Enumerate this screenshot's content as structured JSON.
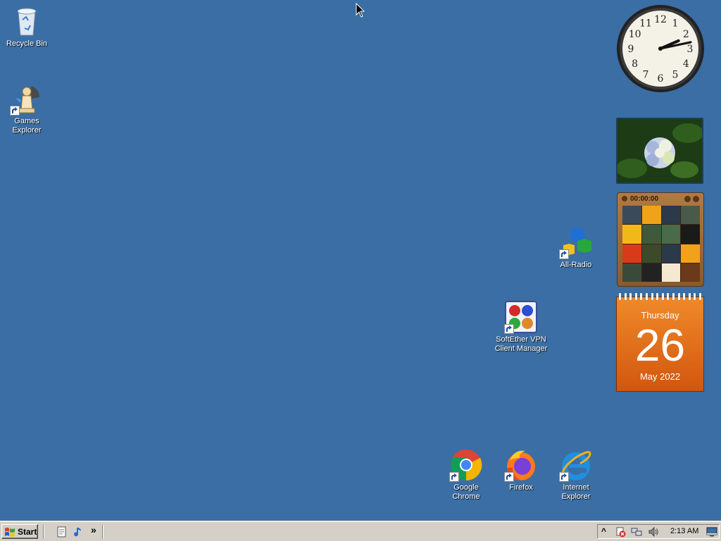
{
  "desktop": {
    "background_color": "#3a6ea5",
    "icons": {
      "recycle_bin": "Recycle Bin",
      "games_explorer": "Games Explorer",
      "all_radio": "All-Radio",
      "softether": "SoftEther VPN Client Manager",
      "google_chrome": "Google Chrome",
      "firefox": "Firefox",
      "internet_explorer": "Internet Explorer"
    }
  },
  "gadgets": {
    "clock": {
      "numerals": [
        "12",
        "1",
        "2",
        "3",
        "4",
        "5",
        "6",
        "7",
        "8",
        "9",
        "10",
        "11"
      ],
      "time": "2:13"
    },
    "puzzle": {
      "timer": "00:00:00"
    },
    "calendar": {
      "weekday": "Thursday",
      "day": "26",
      "month_year": "May 2022"
    }
  },
  "taskbar": {
    "start_label": "Start",
    "quick_launch_overflow": "»",
    "tray_expand": "^",
    "time": "2:13 AM"
  }
}
